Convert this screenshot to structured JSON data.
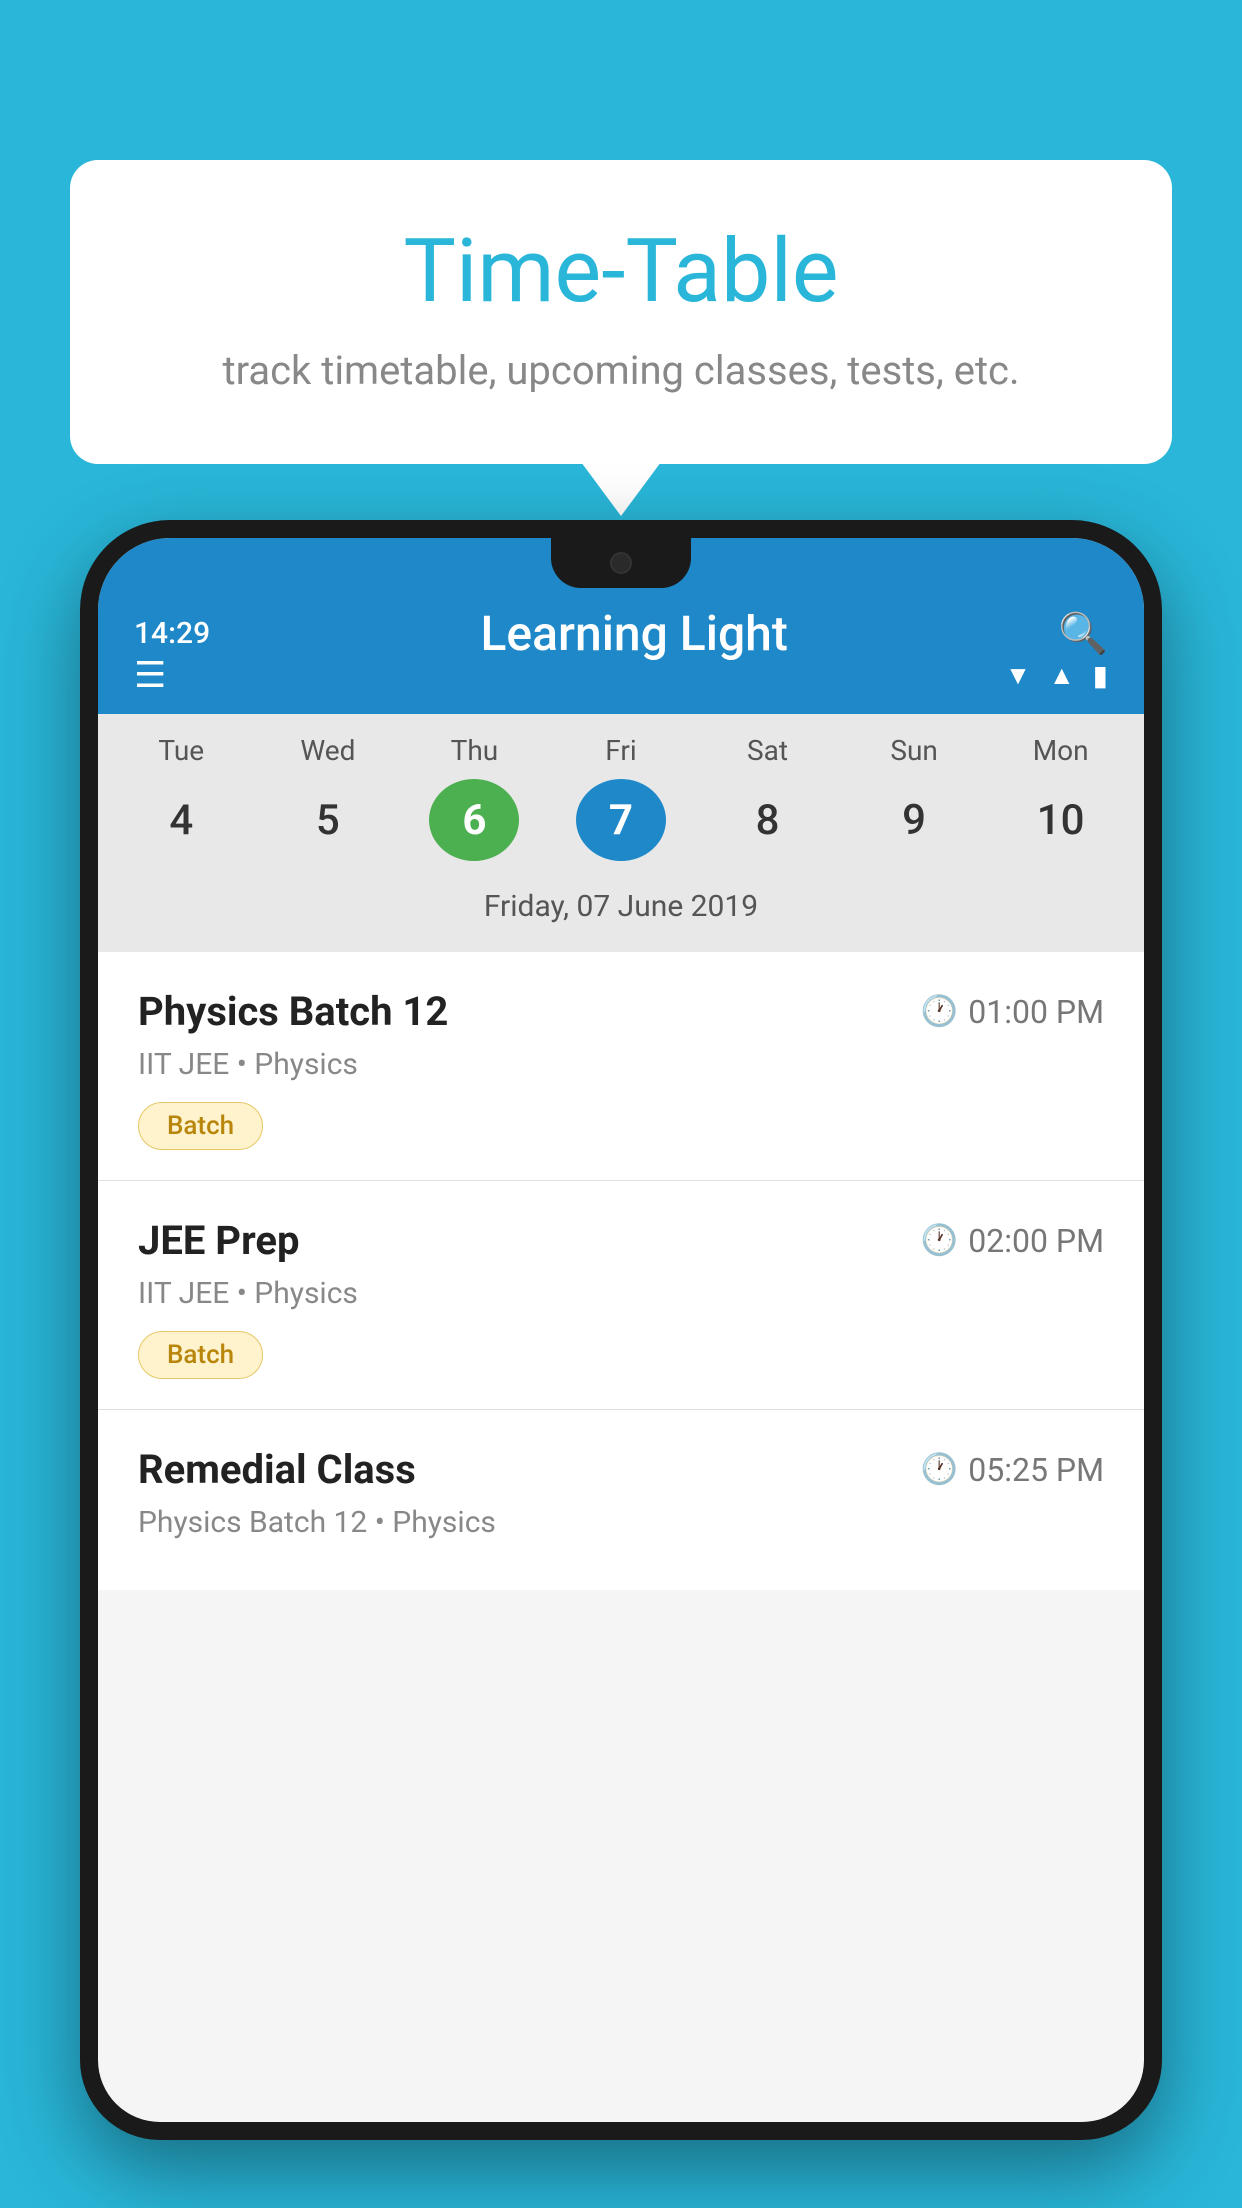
{
  "background_color": "#29b6d8",
  "tooltip": {
    "title": "Time-Table",
    "subtitle": "track timetable, upcoming classes, tests, etc."
  },
  "phone": {
    "status_bar": {
      "time": "14:29"
    },
    "app_bar": {
      "title": "Learning Light"
    },
    "calendar": {
      "days": [
        {
          "label": "Tue",
          "num": "4"
        },
        {
          "label": "Wed",
          "num": "5"
        },
        {
          "label": "Thu",
          "num": "6",
          "style": "today-green"
        },
        {
          "label": "Fri",
          "num": "7",
          "style": "today-blue"
        },
        {
          "label": "Sat",
          "num": "8"
        },
        {
          "label": "Sun",
          "num": "9"
        },
        {
          "label": "Mon",
          "num": "10"
        }
      ],
      "selected_date": "Friday, 07 June 2019"
    },
    "classes": [
      {
        "name": "Physics Batch 12",
        "time": "01:00 PM",
        "meta": "IIT JEE • Physics",
        "tag": "Batch"
      },
      {
        "name": "JEE Prep",
        "time": "02:00 PM",
        "meta": "IIT JEE • Physics",
        "tag": "Batch"
      },
      {
        "name": "Remedial Class",
        "time": "05:25 PM",
        "meta": "Physics Batch 12 • Physics",
        "tag": ""
      }
    ]
  }
}
